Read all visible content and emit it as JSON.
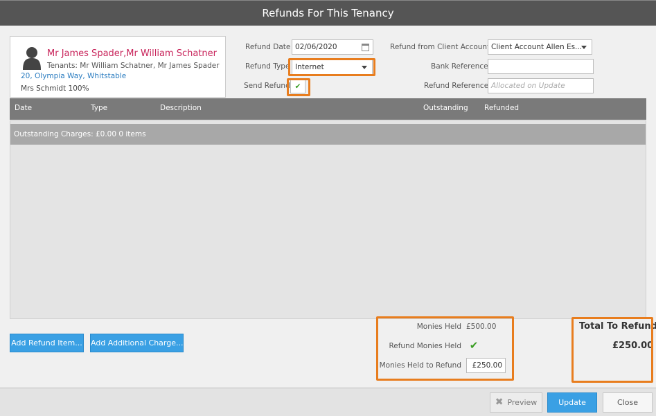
{
  "window": {
    "title": "Refunds For This Tenancy"
  },
  "tenant": {
    "name": "Mr James Spader,Mr William Schatner",
    "tenants_line": "Tenants: Mr William Schatner, Mr James Spader",
    "address": "20, Olympia Way, Whitstable",
    "landlord": "Mrs Schmidt 100%"
  },
  "form": {
    "refund_date_label": "Refund Date",
    "refund_date_value": "02/06/2020",
    "refund_type_label": "Refund Type",
    "refund_type_value": "Internet",
    "send_refund_label": "Send Refund",
    "send_refund_checked": true,
    "refund_from_label": "Refund from Client Account",
    "refund_from_value": "Client Account Allen Es...",
    "bank_reference_label": "Bank Reference",
    "bank_reference_value": "",
    "refund_reference_label": "Refund Reference",
    "refund_reference_placeholder": "Allocated on Update"
  },
  "grid": {
    "columns": [
      "Date",
      "Type",
      "Description",
      "Outstanding",
      "Refunded"
    ],
    "group_row": "Outstanding Charges: £0.00 0 items"
  },
  "actions": {
    "add_refund_item": "Add Refund Item...",
    "add_additional_charge": "Add Additional Charge..."
  },
  "monies": {
    "monies_held_label": "Monies Held",
    "monies_held_value": "£500.00",
    "refund_monies_held_label": "Refund Monies Held",
    "refund_monies_held_checked": true,
    "monies_held_to_refund_label": "Monies Held to Refund",
    "monies_held_to_refund_value": "£250.00"
  },
  "total": {
    "label": "Total To Refund",
    "value": "£250.00"
  },
  "footer": {
    "preview": "Preview",
    "update": "Update",
    "close": "Close"
  },
  "colors": {
    "highlight": "#e87d1e",
    "accent_blue": "#3aa0e4",
    "tenant_name": "#c8235a",
    "link": "#2a7cc0"
  },
  "icons": {
    "avatar": "person-silhouette",
    "calendar": "calendar-icon",
    "check": "checkmark",
    "preview": "x-icon"
  }
}
